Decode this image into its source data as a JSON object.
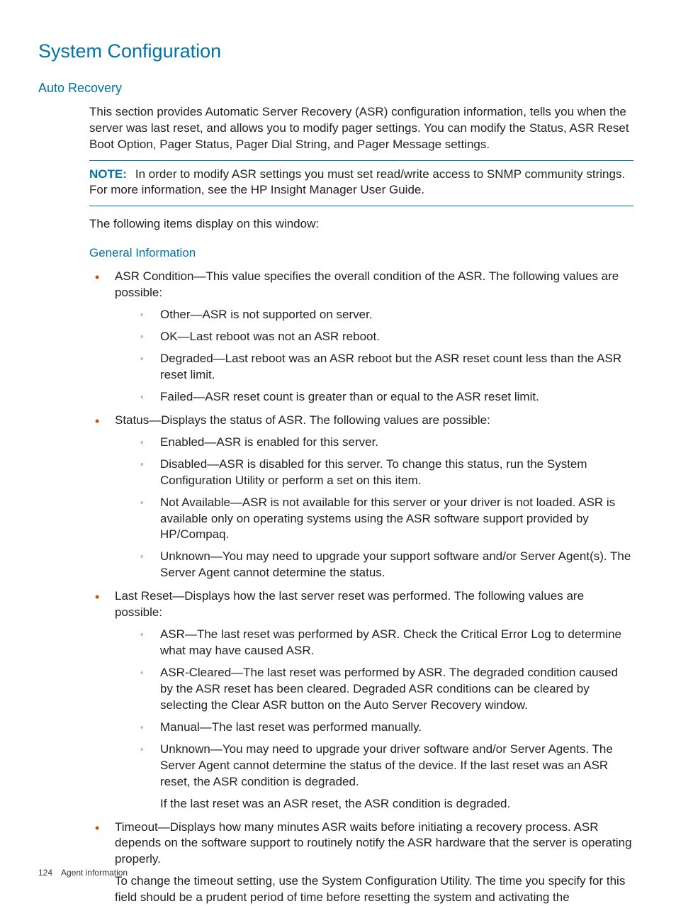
{
  "heading": "System Configuration",
  "subheading": "Auto Recovery",
  "intro": "This section provides Automatic Server Recovery (ASR) configuration information, tells you when the server was last reset, and allows you to modify pager settings. You can modify the Status, ASR Reset Boot Option, Pager Status, Pager Dial String, and Pager Message settings.",
  "note_label": "NOTE:",
  "note_text": "In order to modify ASR settings you must set read/write access to SNMP community strings. For more information, see the HP Insight Manager User Guide.",
  "following": "The following items display on this window:",
  "general_info_heading": "General Information",
  "items": [
    {
      "text": "ASR Condition—This value specifies the overall condition of the ASR. The following values are possible:",
      "sub": [
        {
          "text": "Other—ASR is not supported on server."
        },
        {
          "text": "OK—Last reboot was not an ASR reboot."
        },
        {
          "text": "Degraded—Last reboot was an ASR reboot but the ASR reset count less than the ASR reset limit."
        },
        {
          "text": "Failed—ASR reset count is greater than or equal to the ASR reset limit."
        }
      ]
    },
    {
      "text": "Status—Displays the status of ASR. The following values are possible:",
      "sub": [
        {
          "text": "Enabled—ASR is enabled for this server."
        },
        {
          "text": "Disabled—ASR is disabled for this server. To change this status, run the System Configuration Utility or perform a set on this item."
        },
        {
          "text": "Not Available—ASR is not available for this server or your driver is not loaded. ASR is available only on operating systems using the ASR software support provided by HP/Compaq."
        },
        {
          "text": "Unknown—You may need to upgrade your support software and/or Server Agent(s). The Server Agent cannot determine the status."
        }
      ]
    },
    {
      "text": "Last Reset—Displays how the last server reset was performed. The following values are possible:",
      "sub": [
        {
          "text": "ASR—The last reset was performed by ASR. Check the Critical Error Log to determine what may have caused ASR."
        },
        {
          "text": "ASR-Cleared—The last reset was performed by ASR. The degraded condition caused by the ASR reset has been cleared. Degraded ASR conditions can be cleared by selecting the Clear ASR button on the Auto Server Recovery window."
        },
        {
          "text": "Manual—The last reset was performed manually."
        },
        {
          "text": "Unknown—You may need to upgrade your driver software and/or Server Agents. The Server Agent cannot determine the status of the device. If the last reset was an ASR reset, the ASR condition is degraded.",
          "extra": "If the last reset was an ASR reset, the ASR condition is degraded."
        }
      ]
    },
    {
      "text": "Timeout—Displays how many minutes ASR waits before initiating a recovery process. ASR depends on the software support to routinely notify the ASR hardware that the server is operating properly.",
      "para2": "To change the timeout setting, use the System Configuration Utility. The time you specify for this field should be a prudent period of time before resetting the system and activating the"
    }
  ],
  "footer": {
    "page": "124",
    "section": "Agent information"
  }
}
